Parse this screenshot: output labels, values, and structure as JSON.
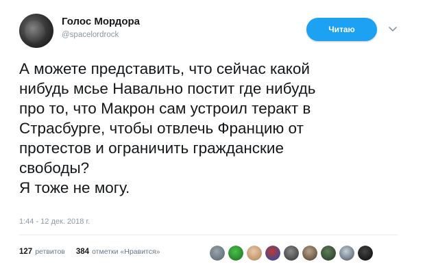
{
  "author": {
    "name": "Голос Мордора",
    "handle": "@spacelordrock"
  },
  "follow_button": {
    "label": "Читаю",
    "color": "#1da1f2"
  },
  "menu_icon": "chevron-down-icon",
  "tweet": {
    "text": "А можете представить, что сейчас какой\nнибудь мсье Навально постит где нибудь\nпро то, что Макрон сам устроил теракт в\nСтрасбурге, чтобы отвлечь Францию от\nпротестов и ограничить гражданские\nсвободы?\nЯ тоже не могу.",
    "timestamp": "1:44 - 12 дек. 2018 г."
  },
  "stats": {
    "retweets_count": "127",
    "retweets_label": "ретвитов",
    "likes_count": "384",
    "likes_label": "отметки «Нравится»"
  },
  "likers": [
    {
      "colors": [
        "#9aa4ad",
        "#5f6b75"
      ]
    },
    {
      "colors": [
        "#49c04a",
        "#1f7a25"
      ]
    },
    {
      "colors": [
        "#e8c9a8",
        "#b88a5e"
      ]
    },
    {
      "colors": [
        "#c4362f",
        "#2b4fa0"
      ]
    },
    {
      "colors": [
        "#8a8a8a",
        "#3b3b3b"
      ]
    },
    {
      "colors": [
        "#b9a58a",
        "#5a4634"
      ]
    },
    {
      "colors": [
        "#5d7d58",
        "#2e3f2c"
      ]
    },
    {
      "colors": [
        "#c7d0d6",
        "#566370"
      ]
    },
    {
      "colors": [
        "#444444",
        "#111111"
      ]
    }
  ]
}
